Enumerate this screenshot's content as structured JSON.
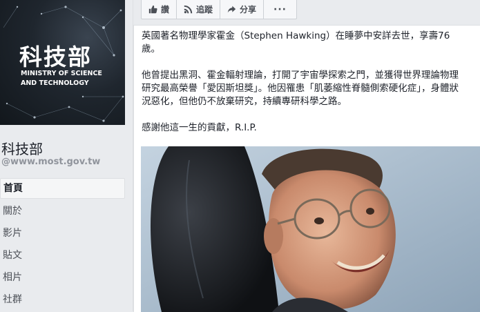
{
  "page": {
    "cover": {
      "title_zh": "科技部",
      "title_en_line1": "MINISTRY OF SCIENCE",
      "title_en_line2": "AND TECHNOLOGY"
    },
    "name": "科技部",
    "handle": "@www.most.gov.tw"
  },
  "nav": {
    "items": [
      {
        "label": "首頁",
        "active": true
      },
      {
        "label": "關於",
        "active": false
      },
      {
        "label": "影片",
        "active": false
      },
      {
        "label": "貼文",
        "active": false
      },
      {
        "label": "相片",
        "active": false
      },
      {
        "label": "社群",
        "active": false
      }
    ]
  },
  "actions": {
    "like_label": "讚",
    "like_icon": "thumbs-up-icon",
    "follow_label": "追蹤",
    "follow_icon": "rss-icon",
    "share_label": "分享",
    "share_icon": "share-arrow-icon",
    "more_label": "···"
  },
  "post": {
    "paragraph1": "英國著名物理學家霍金（Stephen Hawking）在睡夢中安詳去世，享壽76歲。",
    "paragraph2": "他曾提出黑洞、霍金輻射理論，打開了宇宙學探索之門，並獲得世界理論物理研究最高榮譽「愛因斯坦獎」。他因罹患「肌萎縮性脊髓側索硬化症」，身體狀況惡化，但他仍不放棄研究，持續專研科學之路。",
    "paragraph3": "感謝他這一生的貢獻，R.I.P.",
    "photo": "portrait-photo"
  },
  "colors": {
    "background": "#e9ebee",
    "text": "#1d2129",
    "muted": "#90949c",
    "cover_bg": "#1f262e"
  }
}
